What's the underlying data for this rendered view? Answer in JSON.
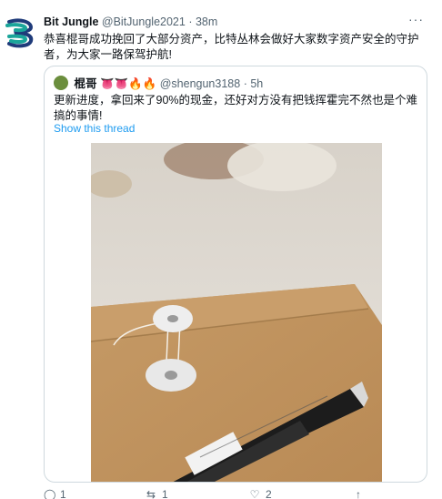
{
  "tweet": {
    "author_name": "Bit Jungle",
    "author_handle": "@BitJungle2021",
    "separator": "·",
    "time": "38m",
    "more_label": "···",
    "text": "恭喜棍哥成功挽回了大部分资产，比特丛林会做好大家数字资产安全的守护者，为大家一路保驾护航!"
  },
  "quote": {
    "author_name": "棍哥",
    "author_emojis": "👅👅🔥🔥",
    "author_handle": "@shengun3188",
    "separator": "·",
    "time": "5h",
    "text": "更新进度，拿回来了90%的现金，还好对方没有把钱挥霍完不然也是个难搞的事情!",
    "show_thread_label": "Show this thread"
  },
  "actions": {
    "reply_count": "1",
    "retweet_count": "1",
    "like_count": "2",
    "share_label": ""
  },
  "colors": {
    "link": "#1d9bf0",
    "muted": "#536471",
    "border": "#cfd9de",
    "logo_teal": "#1aa59a",
    "logo_navy": "#1f3b7a"
  }
}
